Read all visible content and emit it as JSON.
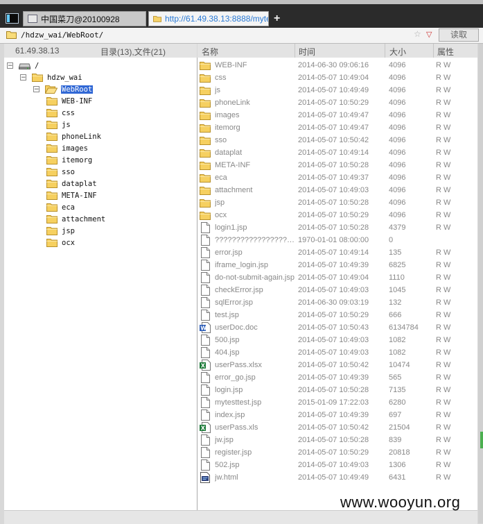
{
  "browser": {
    "tabs": [
      {
        "label": "中国菜刀@20100928"
      },
      {
        "label": "http://61.49.38.13:8888/myte..."
      }
    ],
    "new_tab_glyph": "+"
  },
  "address": {
    "path": "/hdzw_wai/WebRoot/",
    "star_glyph": "☆",
    "dropdown_glyph": "▽",
    "read_button": "读取"
  },
  "left_header": {
    "ip": "61.49.38.13",
    "summary": "目录(13),文件(21)"
  },
  "columns": {
    "name": "名称",
    "time": "时间",
    "size": "大小",
    "attr": "属性"
  },
  "tree": [
    {
      "name": "/",
      "depth": 0,
      "toggle": "−",
      "icon": "drive-icon"
    },
    {
      "name": "hdzw_wai",
      "depth": 1,
      "toggle": "−",
      "icon": "folder-icon"
    },
    {
      "name": "WebRoot",
      "depth": 2,
      "toggle": "−",
      "icon": "folder-open-icon",
      "selected": true
    },
    {
      "name": "WEB-INF",
      "depth": 3,
      "icon": "folder-icon"
    },
    {
      "name": "css",
      "depth": 3,
      "icon": "folder-icon"
    },
    {
      "name": "js",
      "depth": 3,
      "icon": "folder-icon"
    },
    {
      "name": "phoneLink",
      "depth": 3,
      "icon": "folder-icon"
    },
    {
      "name": "images",
      "depth": 3,
      "icon": "folder-icon"
    },
    {
      "name": "itemorg",
      "depth": 3,
      "icon": "folder-icon"
    },
    {
      "name": "sso",
      "depth": 3,
      "icon": "folder-icon"
    },
    {
      "name": "dataplat",
      "depth": 3,
      "icon": "folder-icon"
    },
    {
      "name": "META-INF",
      "depth": 3,
      "icon": "folder-icon"
    },
    {
      "name": "eca",
      "depth": 3,
      "icon": "folder-icon"
    },
    {
      "name": "attachment",
      "depth": 3,
      "icon": "folder-icon"
    },
    {
      "name": "jsp",
      "depth": 3,
      "icon": "folder-icon"
    },
    {
      "name": "ocx",
      "depth": 3,
      "icon": "folder-icon"
    }
  ],
  "files": [
    {
      "name": "WEB-INF",
      "time": "2014-06-30 09:06:16",
      "size": "4096",
      "attr": "R W",
      "icon": "folder-icon"
    },
    {
      "name": "css",
      "time": "2014-05-07 10:49:04",
      "size": "4096",
      "attr": "R W",
      "icon": "folder-icon"
    },
    {
      "name": "js",
      "time": "2014-05-07 10:49:49",
      "size": "4096",
      "attr": "R W",
      "icon": "folder-icon"
    },
    {
      "name": "phoneLink",
      "time": "2014-05-07 10:50:29",
      "size": "4096",
      "attr": "R W",
      "icon": "folder-icon"
    },
    {
      "name": "images",
      "time": "2014-05-07 10:49:47",
      "size": "4096",
      "attr": "R W",
      "icon": "folder-icon"
    },
    {
      "name": "itemorg",
      "time": "2014-05-07 10:49:47",
      "size": "4096",
      "attr": "R W",
      "icon": "folder-icon"
    },
    {
      "name": "sso",
      "time": "2014-05-07 10:50:42",
      "size": "4096",
      "attr": "R W",
      "icon": "folder-icon"
    },
    {
      "name": "dataplat",
      "time": "2014-05-07 10:49:14",
      "size": "4096",
      "attr": "R W",
      "icon": "folder-icon"
    },
    {
      "name": "META-INF",
      "time": "2014-05-07 10:50:28",
      "size": "4096",
      "attr": "R W",
      "icon": "folder-icon"
    },
    {
      "name": "eca",
      "time": "2014-05-07 10:49:37",
      "size": "4096",
      "attr": "R W",
      "icon": "folder-icon"
    },
    {
      "name": "attachment",
      "time": "2014-05-07 10:49:03",
      "size": "4096",
      "attr": "R W",
      "icon": "folder-icon"
    },
    {
      "name": "jsp",
      "time": "2014-05-07 10:50:28",
      "size": "4096",
      "attr": "R W",
      "icon": "folder-icon"
    },
    {
      "name": "ocx",
      "time": "2014-05-07 10:50:29",
      "size": "4096",
      "attr": "R W",
      "icon": "folder-icon"
    },
    {
      "name": "login1.jsp",
      "time": "2014-05-07 10:50:28",
      "size": "4379",
      "attr": "R W",
      "icon": "file-icon"
    },
    {
      "name": "??????????????????...",
      "time": "1970-01-01 08:00:00",
      "size": "0",
      "attr": "",
      "icon": "file-icon"
    },
    {
      "name": "error.jsp",
      "time": "2014-05-07 10:49:14",
      "size": "135",
      "attr": "R W",
      "icon": "file-icon"
    },
    {
      "name": "iframe_login.jsp",
      "time": "2014-05-07 10:49:39",
      "size": "6825",
      "attr": "R W",
      "icon": "file-icon"
    },
    {
      "name": "do-not-submit-again.jsp",
      "time": "2014-05-07 10:49:04",
      "size": "1110",
      "attr": "R W",
      "icon": "file-icon"
    },
    {
      "name": "checkError.jsp",
      "time": "2014-05-07 10:49:03",
      "size": "1045",
      "attr": "R W",
      "icon": "file-icon"
    },
    {
      "name": "sqlError.jsp",
      "time": "2014-06-30 09:03:19",
      "size": "132",
      "attr": "R W",
      "icon": "file-icon"
    },
    {
      "name": "test.jsp",
      "time": "2014-05-07 10:50:29",
      "size": "666",
      "attr": "R W",
      "icon": "file-icon"
    },
    {
      "name": "userDoc.doc",
      "time": "2014-05-07 10:50:43",
      "size": "6134784",
      "attr": "R W",
      "icon": "word-doc-icon"
    },
    {
      "name": "500.jsp",
      "time": "2014-05-07 10:49:03",
      "size": "1082",
      "attr": "R W",
      "icon": "file-icon"
    },
    {
      "name": "404.jsp",
      "time": "2014-05-07 10:49:03",
      "size": "1082",
      "attr": "R W",
      "icon": "file-icon"
    },
    {
      "name": "userPass.xlsx",
      "time": "2014-05-07 10:50:42",
      "size": "10474",
      "attr": "R W",
      "icon": "excel-icon"
    },
    {
      "name": "error_go.jsp",
      "time": "2014-05-07 10:49:39",
      "size": "565",
      "attr": "R W",
      "icon": "file-icon"
    },
    {
      "name": "login.jsp",
      "time": "2014-05-07 10:50:28",
      "size": "7135",
      "attr": "R W",
      "icon": "file-icon"
    },
    {
      "name": "mytesttest.jsp",
      "time": "2015-01-09 17:22:03",
      "size": "6280",
      "attr": "R W",
      "icon": "file-icon"
    },
    {
      "name": "index.jsp",
      "time": "2014-05-07 10:49:39",
      "size": "697",
      "attr": "R W",
      "icon": "file-icon"
    },
    {
      "name": "userPass.xls",
      "time": "2014-05-07 10:50:42",
      "size": "21504",
      "attr": "R W",
      "icon": "excel-icon"
    },
    {
      "name": "jw.jsp",
      "time": "2014-05-07 10:50:28",
      "size": "839",
      "attr": "R W",
      "icon": "file-icon"
    },
    {
      "name": "register.jsp",
      "time": "2014-05-07 10:50:29",
      "size": "20818",
      "attr": "R W",
      "icon": "file-icon"
    },
    {
      "name": "502.jsp",
      "time": "2014-05-07 10:49:03",
      "size": "1306",
      "attr": "R W",
      "icon": "file-icon"
    },
    {
      "name": "jw.html",
      "time": "2014-05-07 10:49:49",
      "size": "6431",
      "attr": "R W",
      "icon": "html-icon"
    }
  ],
  "watermark": "www.wooyun.org",
  "colors": {
    "selection": "#3168d5",
    "folder": "#f0c040",
    "tab_link": "#2a7ad5"
  }
}
